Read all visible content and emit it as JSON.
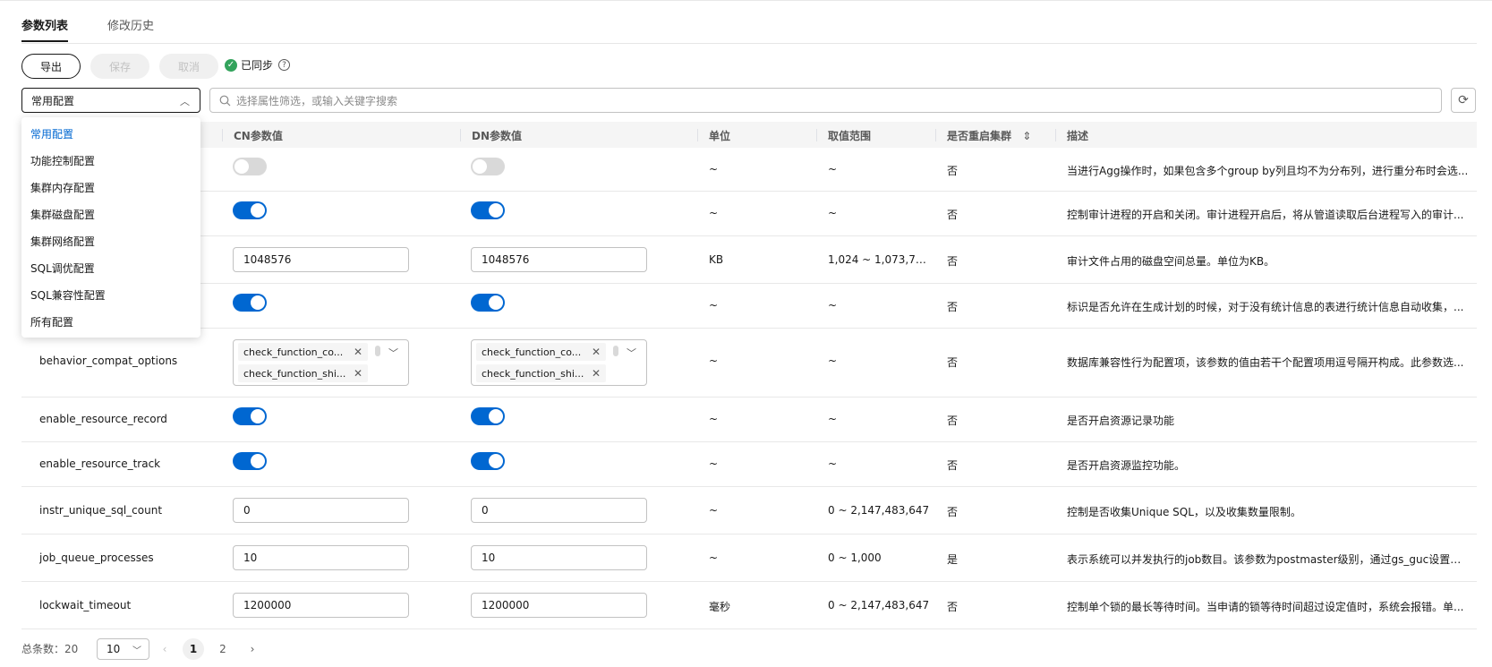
{
  "tabs": [
    {
      "label": "参数列表"
    },
    {
      "label": "修改历史"
    }
  ],
  "toolbar": {
    "export": "导出",
    "save": "保存",
    "cancel": "取消",
    "sync_status": "已同步"
  },
  "filter": {
    "selected": "常用配置",
    "search_placeholder": "选择属性筛选，或输入关键字搜索"
  },
  "dropdown_options": [
    "常用配置",
    "功能控制配置",
    "集群内存配置",
    "集群磁盘配置",
    "集群网络配置",
    "SQL调优配置",
    "SQL兼容性配置",
    "所有配置"
  ],
  "columns": {
    "cn": "CN参数值",
    "dn": "DN参数值",
    "unit": "单位",
    "range": "取值范围",
    "restart": "是否重启集群",
    "desc": "描述"
  },
  "rows": [
    {
      "name": "",
      "type": "toggle",
      "cn": "off",
      "dn": "off",
      "unit": "~",
      "range": "~",
      "restart": "否",
      "desc": "当进行Agg操作时，如果包含多个group by列且均不为分布列，进行重分布时会选..."
    },
    {
      "name": "",
      "type": "toggle",
      "cn": "on",
      "dn": "on",
      "unit": "~",
      "range": "~",
      "restart": "否",
      "desc": "控制审计进程的开启和关闭。审计进程开启后，将从管道读取后台进程写入的审计..."
    },
    {
      "name": "",
      "type": "input",
      "cn": "1048576",
      "dn": "1048576",
      "unit": "KB",
      "range": "1,024 ~ 1,073,741,...",
      "restart": "否",
      "desc": "审计文件占用的磁盘空间总量。单位为KB。"
    },
    {
      "name": "",
      "type": "toggle",
      "cn": "on",
      "dn": "on",
      "unit": "~",
      "range": "~",
      "restart": "否",
      "desc": "标识是否允许在生成计划的时候，对于没有统计信息的表进行统计信息自动收集，..."
    },
    {
      "name": "behavior_compat_options",
      "type": "multi",
      "cn_tags": [
        "check_function_co...",
        "check_function_shi..."
      ],
      "dn_tags": [
        "check_function_co...",
        "check_function_shi..."
      ],
      "unit": "~",
      "range": "~",
      "restart": "否",
      "desc": "数据库兼容性行为配置项，该参数的值由若干个配置项用逗号隔开构成。此参数选..."
    },
    {
      "name": "enable_resource_record",
      "type": "toggle",
      "cn": "on",
      "dn": "on",
      "unit": "~",
      "range": "~",
      "restart": "否",
      "desc": "是否开启资源记录功能"
    },
    {
      "name": "enable_resource_track",
      "type": "toggle",
      "cn": "on",
      "dn": "on",
      "unit": "~",
      "range": "~",
      "restart": "否",
      "desc": "是否开启资源监控功能。"
    },
    {
      "name": "instr_unique_sql_count",
      "type": "input",
      "cn": "0",
      "dn": "0",
      "unit": "~",
      "range": "0 ~ 2,147,483,647",
      "restart": "否",
      "desc": "控制是否收集Unique SQL，以及收集数量限制。"
    },
    {
      "name": "job_queue_processes",
      "type": "input",
      "cn": "10",
      "dn": "10",
      "unit": "~",
      "range": "0 ~ 1,000",
      "restart": "是",
      "desc": "表示系统可以并发执行的job数目。该参数为postmaster级别，通过gs_guc设置，..."
    },
    {
      "name": "lockwait_timeout",
      "type": "input",
      "cn": "1200000",
      "dn": "1200000",
      "unit": "毫秒",
      "range": "0 ~ 2,147,483,647",
      "restart": "否",
      "desc": "控制单个锁的最长等待时间。当申请的锁等待时间超过设定值时，系统会报错。单..."
    }
  ],
  "pagination": {
    "total_label": "总条数：20",
    "page_size": "10",
    "pages": [
      "1",
      "2"
    ],
    "current": "1"
  },
  "colors": {
    "accent": "#0067d1",
    "success": "#33a35c",
    "header_bg": "#f5f5f5"
  }
}
